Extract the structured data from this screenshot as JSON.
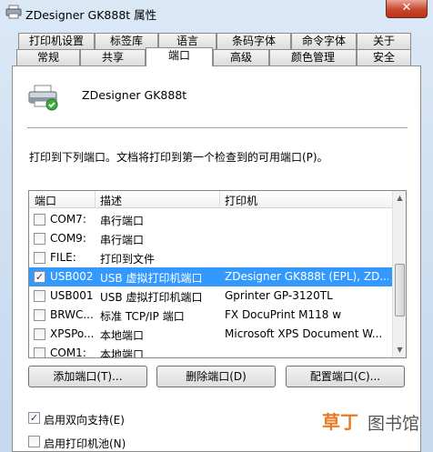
{
  "window": {
    "title": "ZDesigner GK888t 属性",
    "close_label": "✕"
  },
  "tabs_back": [
    "打印机设置",
    "标签库",
    "语言",
    "条码字体",
    "命令字体",
    "关于"
  ],
  "tabs_front": [
    "常规",
    "共享",
    "端口",
    "高级",
    "颜色管理",
    "安全"
  ],
  "selected_tab": "端口",
  "printer": {
    "name": "ZDesigner GK888t"
  },
  "description": "打印到下列端口。文档将打印到第一个检查到的可用端口(P)。",
  "port_list": {
    "columns": [
      "端口",
      "描述",
      "打印机"
    ],
    "rows": [
      {
        "checked": false,
        "port": "COM7:",
        "desc": "串行端口",
        "printer": ""
      },
      {
        "checked": false,
        "port": "COM9:",
        "desc": "串行端口",
        "printer": ""
      },
      {
        "checked": false,
        "port": "FILE:",
        "desc": "打印到文件",
        "printer": ""
      },
      {
        "checked": true,
        "port": "USB002",
        "desc": "USB 虚拟打印机端口",
        "printer": "ZDesigner GK888t (EPL), ZD..."
      },
      {
        "checked": false,
        "port": "USB001",
        "desc": "USB 虚拟打印机端口",
        "printer": "Gprinter  GP-3120TL"
      },
      {
        "checked": false,
        "port": "BRWC...",
        "desc": "标准 TCP/IP 端口",
        "printer": "FX DocuPrint M118 w"
      },
      {
        "checked": false,
        "port": "XPSPo...",
        "desc": "本地端口",
        "printer": "Microsoft XPS Document W..."
      },
      {
        "checked": false,
        "port": "COM1:",
        "desc": "本地端口",
        "printer": ""
      }
    ]
  },
  "buttons": {
    "add_port": "添加端口(T)...",
    "delete_port": "删除端口(D)",
    "configure_port": "配置端口(C)..."
  },
  "options": {
    "bidirectional": {
      "label": "启用双向支持(E)",
      "checked": true
    },
    "pooling": {
      "label": "启用打印机池(N)",
      "checked": false
    }
  },
  "watermark": {
    "logo": "草丁",
    "text": "图书馆"
  },
  "colors": {
    "selection": "#3399ff",
    "close_button": "#c9462c",
    "watermark_orange": "#e97a25"
  }
}
